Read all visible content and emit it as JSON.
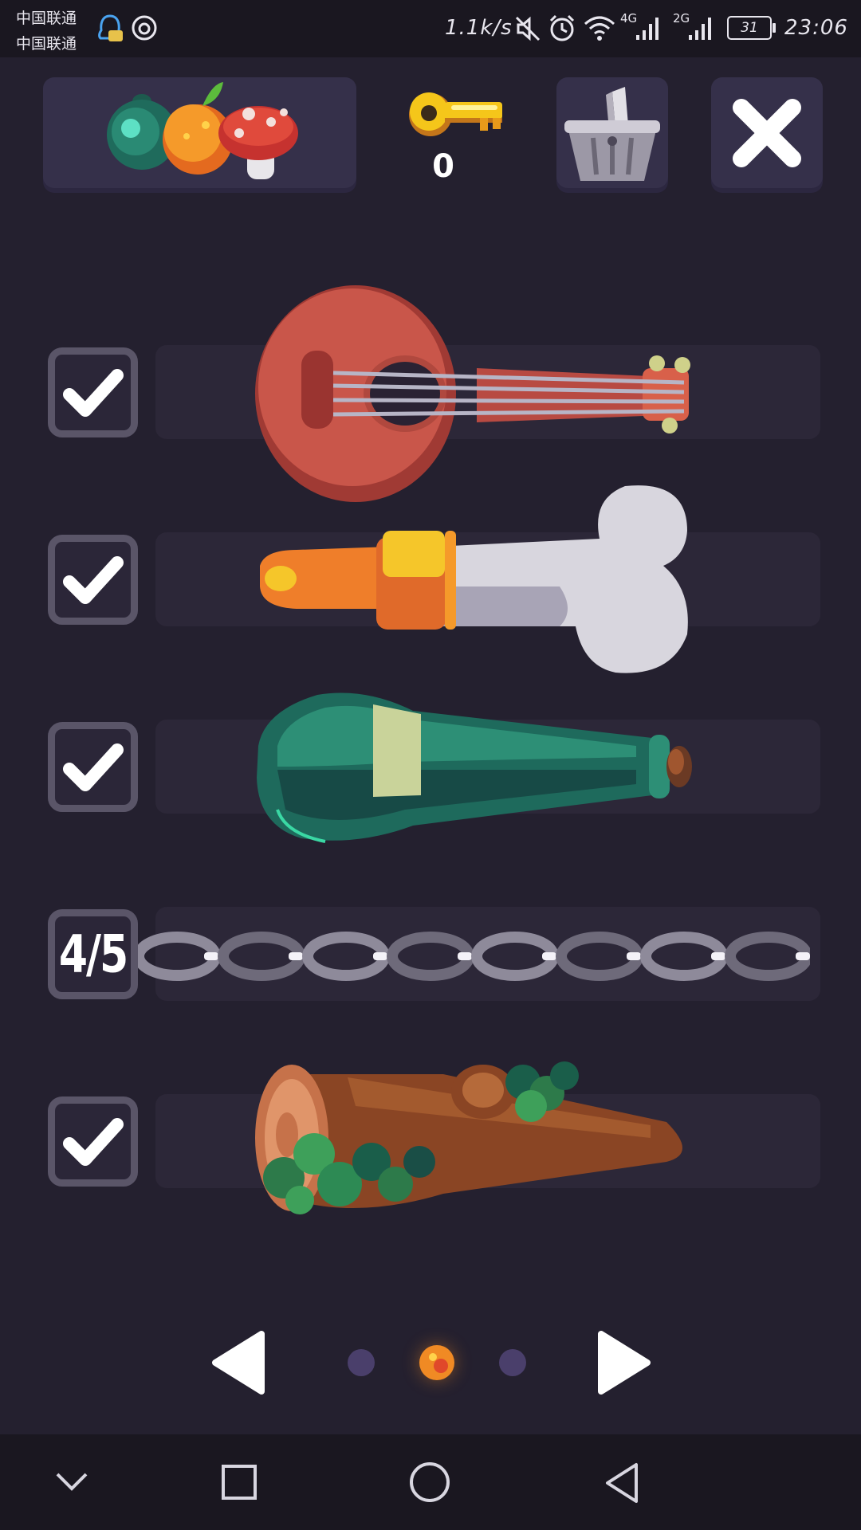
{
  "status_bar": {
    "carrier_1": "中国联通",
    "carrier_2": "中国联通",
    "network_speed": "1.1k/s",
    "network_4g": "4G",
    "network_2g": "2G",
    "battery": "31",
    "time": "23:06"
  },
  "header": {
    "key_count": "0",
    "category_icon": "fruit-potion-mushroom-icon",
    "shop_icon": "basket-icon",
    "close_icon": "close-icon"
  },
  "items": [
    {
      "name": "lute",
      "status": "checked",
      "icon": "checkmark-icon"
    },
    {
      "name": "bone",
      "status": "checked",
      "icon": "checkmark-icon"
    },
    {
      "name": "bottle",
      "status": "checked",
      "icon": "checkmark-icon"
    },
    {
      "name": "chain",
      "status": "progress",
      "progress_label": "4/5",
      "progress": 0.8
    },
    {
      "name": "log",
      "status": "checked",
      "icon": "checkmark-icon"
    }
  ],
  "pagination": {
    "pages": 3,
    "current_page": 2
  },
  "colors": {
    "background": "#24202f",
    "panel": "#35304a",
    "active_dot": "#f08a24",
    "inactive_dot": "#4a3f6b"
  }
}
